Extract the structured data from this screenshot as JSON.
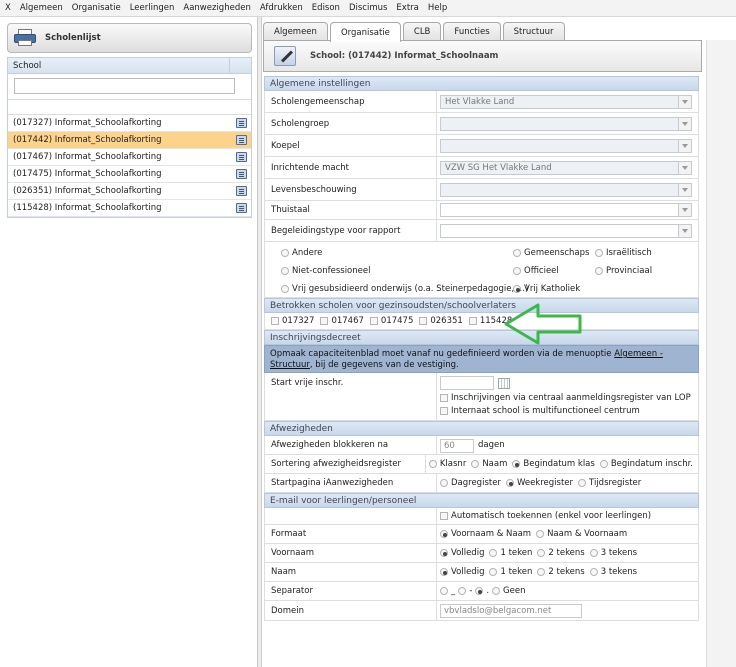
{
  "menu": [
    "X",
    "Algemeen",
    "Organisatie",
    "Leerlingen",
    "Aanwezigheden",
    "Afdrukken",
    "Edison",
    "Discimus",
    "Extra",
    "Help"
  ],
  "left": {
    "button_label": "Scholenlijst",
    "column_header": "School",
    "filter_value": "",
    "schools": [
      {
        "name": "(017327) Informat_Schoolafkorting",
        "selected": false
      },
      {
        "name": "(017442) Informat_Schoolafkorting",
        "selected": true
      },
      {
        "name": "(017467) Informat_Schoolafkorting",
        "selected": false
      },
      {
        "name": "(017475) Informat_Schoolafkorting",
        "selected": false
      },
      {
        "name": "(026351) Informat_Schoolafkorting",
        "selected": false
      },
      {
        "name": "(115428) Informat_Schoolafkorting",
        "selected": false
      }
    ]
  },
  "tabs": [
    {
      "label": "Algemeen",
      "active": false
    },
    {
      "label": "Organisatie",
      "active": true
    },
    {
      "label": "CLB",
      "active": false
    },
    {
      "label": "Functies",
      "active": false
    },
    {
      "label": "Structuur",
      "active": false
    }
  ],
  "header_title": "School: (017442) Informat_Schoolnaam",
  "algemeen": {
    "section": "Algemene instellingen",
    "fields": [
      {
        "label": "Scholengemeenschap",
        "value": "Het Vlakke Land"
      },
      {
        "label": "Scholengroep",
        "value": ""
      },
      {
        "label": "Koepel",
        "value": ""
      },
      {
        "label": "Inrichtende macht",
        "value": "VZW SG Het Vlakke Land"
      },
      {
        "label": "Levensbeschouwing",
        "value": ""
      },
      {
        "label": "Thuistaal",
        "value": ""
      },
      {
        "label": "Begeleidingstype voor rapport",
        "value": ""
      }
    ],
    "net_options_col1": [
      "Andere",
      "Niet-confessioneel",
      "Vrij gesubsidieerd onderwijs (o.a. Steinerpedagogie, ...)"
    ],
    "net_options_col2": [
      "Gemeenschaps",
      "Officieel",
      "Vrij Katholiek"
    ],
    "net_options_col3": [
      "Israëlitisch",
      "Provinciaal"
    ],
    "net_selected": "Vrij Katholiek"
  },
  "betrokken": {
    "section": "Betrokken scholen voor gezinsoudsten/schoolverlaters",
    "schools": [
      "017327",
      "017467",
      "017475",
      "026351",
      "115428"
    ]
  },
  "inschrijving": {
    "section": "Inschrijvingsdecreet",
    "info_prefix": "Opmaak capaciteitenblad moet vanaf nu gedefinieerd worden via de menuoptie ",
    "info_link": "Algemeen - Structuur",
    "info_suffix": ", bij de gegevens van de vestiging.",
    "start_label": "Start vrije inschr.",
    "start_value": "",
    "check1": "Inschrijvingen via centraal aanmeldingsregister van LOP",
    "check2": "Internaat school is multifunctioneel centrum"
  },
  "afwezigheden": {
    "section": "Afwezigheden",
    "block_label": "Afwezigheden blokkeren na",
    "block_value": "60",
    "block_unit": "dagen",
    "sort_label": "Sortering afwezigheidsregister",
    "sort_options": [
      "Klasnr",
      "Naam",
      "Begindatum klas",
      "Begindatum inschr."
    ],
    "sort_selected": "Begindatum klas",
    "start_label": "Startpagina iAanwezigheden",
    "start_options": [
      "Dagregister",
      "Weekregister",
      "Tijdsregister"
    ],
    "start_selected": "Weekregister"
  },
  "email": {
    "section": "E-mail voor leerlingen/personeel",
    "auto_label": "Automatisch toekennen (enkel voor leerlingen)",
    "format_label": "Formaat",
    "format_options": [
      "Voornaam & Naam",
      "Naam & Voornaam"
    ],
    "format_selected": "Voornaam & Naam",
    "voornaam_label": "Voornaam",
    "naam_label": "Naam",
    "length_options": [
      "Volledig",
      "1 teken",
      "2 tekens",
      "3 tekens"
    ],
    "voornaam_selected": "Volledig",
    "naam_selected": "Volledig",
    "separator_label": "Separator",
    "separator_options": [
      "_",
      "-",
      ".",
      "Geen"
    ],
    "separator_selected": ".",
    "domain_label": "Domein",
    "domain_value": "vbvladslo@belgacom.net"
  },
  "colors": {
    "selected_row": "#fbd38a",
    "section_bg": "#c8d8ea",
    "info_bg": "#9fb4d0",
    "arrow": "#3cb84a"
  }
}
